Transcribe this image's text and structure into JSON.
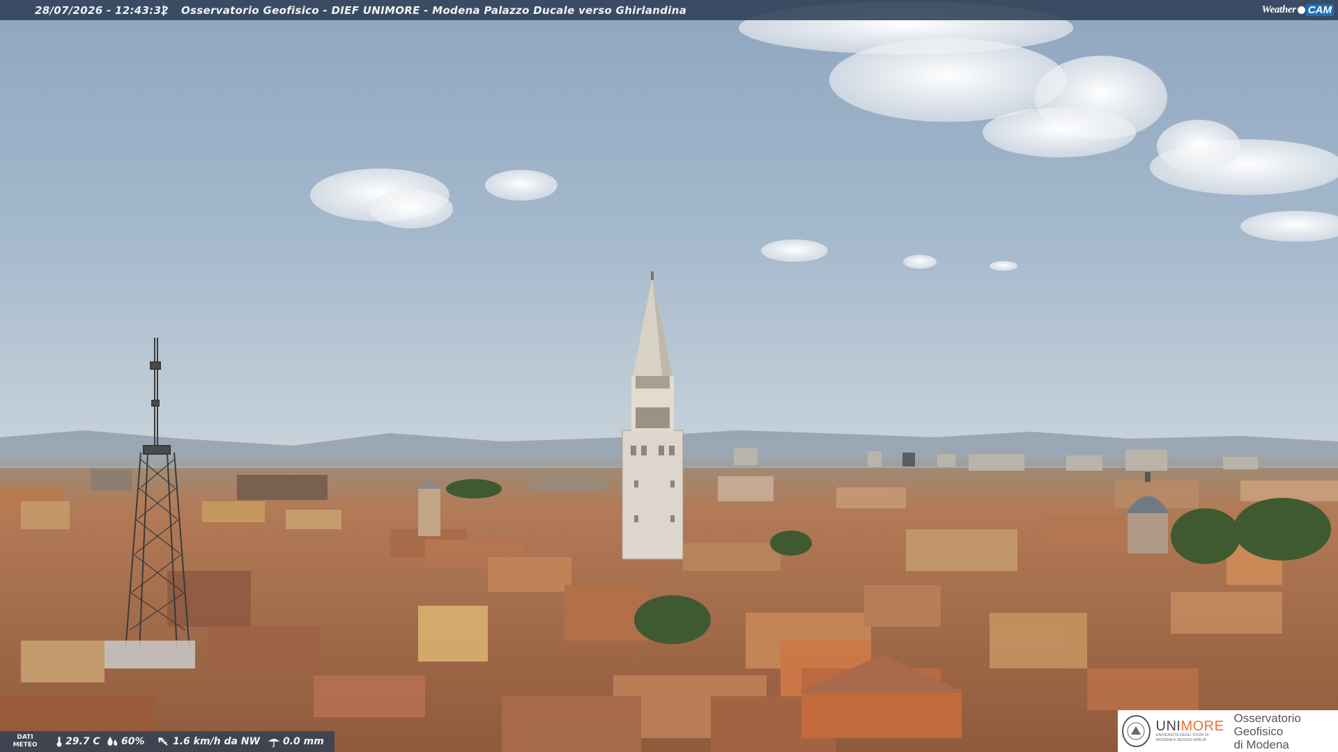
{
  "header": {
    "timestamp": "28/07/2026 - 12:43:32",
    "separator": "|",
    "title": "Osservatorio Geofisico - DIEF UNIMORE - Modena Palazzo Ducale verso Ghirlandina"
  },
  "logo": {
    "weather_text": "Weather",
    "cam_text": "CAM"
  },
  "weather_bar": {
    "label_line1": "DATI",
    "label_line2": "METEO",
    "temperature": "29.7 C",
    "humidity": "60%",
    "wind": "1.6 km/h da NW",
    "rain": "0.0 mm",
    "icons": [
      "thermometer-icon",
      "humidity-drop-icon",
      "wind-icon",
      "rain-icon"
    ]
  },
  "unimore_logo": {
    "uni_text": "UNI",
    "more_text": "MORE",
    "university_line1": "UNIVERSITÀ DEGLI STUDI DI",
    "university_line2": "MODENA E REGGIO EMILIA",
    "observatory_line1": "Osservatorio Geofisico",
    "observatory_line2": "di Modena"
  },
  "colors": {
    "bar_background": "#2e4056",
    "unimore_orange": "#e8702a",
    "sky": "#9fb4c9",
    "roof_terracotta": "#b5714a"
  }
}
